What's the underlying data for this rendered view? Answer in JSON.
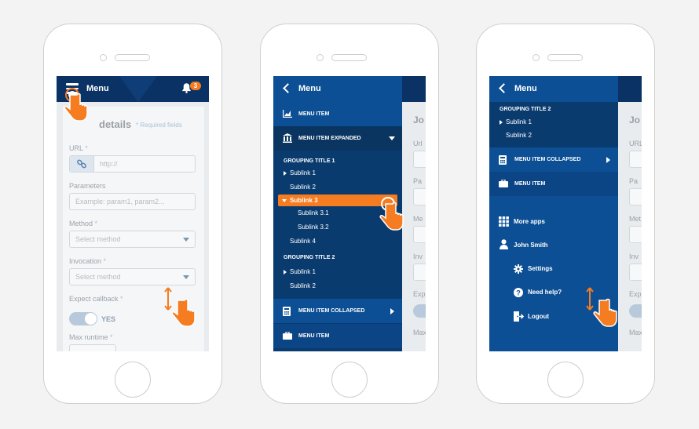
{
  "phone1": {
    "header_title": "Menu",
    "notification_count": "3",
    "form": {
      "title": "details",
      "required_note": "* Required fields",
      "url_label": "URL",
      "url_required": "*",
      "url_placeholder": "http://",
      "params_label": "Parameters",
      "params_placeholder": "Example: param1, param2...",
      "method_label": "Method",
      "method_required": "*",
      "method_placeholder": "Select method",
      "invocation_label": "Invocation",
      "invocation_required": "*",
      "invocation_placeholder": "Select method",
      "callback_label": "Expect callback",
      "callback_required": "*",
      "callback_toggle": "YES",
      "runtime_label": "Max runtime",
      "runtime_required": "*"
    }
  },
  "phone2": {
    "header_title": "Menu",
    "menu_item_1": "MENU ITEM",
    "menu_expanded": "MENU ITEM EXPANDED",
    "group_title_1": "GROUPING TITLE 1",
    "sublink_1": "Sublink 1",
    "sublink_2": "Sublink 2",
    "sublink_3": "Sublink 3",
    "sublink_3_1": "Sublink 3.1",
    "sublink_3_2": "Sublink 3.2",
    "sublink_4": "Sublink 4",
    "group_title_2": "GROUPING TITLE 2",
    "g2_sublink_1": "Sublink 1",
    "g2_sublink_2": "Sublink 2",
    "menu_collapsed": "MENU ITEM COLLAPSED",
    "menu_item_2": "MENU ITEM",
    "bg_text": [
      "Jo",
      "Url",
      "Pa",
      "Me",
      "Inv",
      "Exp",
      "Max"
    ]
  },
  "phone3": {
    "header_title": "Menu",
    "group_title_2": "GROUPING TITLE 2",
    "sublink_1": "Sublink 1",
    "sublink_2": "Sublink 2",
    "menu_collapsed": "MENU ITEM COLLAPSED",
    "menu_item": "MENU ITEM",
    "more_apps": "More apps",
    "user_name": "John Smith",
    "settings": "Settings",
    "help": "Need help?",
    "logout": "Logout",
    "bg_text": [
      "Jo",
      "URL",
      "Pa",
      "Met",
      "Inv",
      "Exp",
      "Max"
    ]
  },
  "colors": {
    "navy": "#0b3265",
    "menu_blue": "#0c4f94",
    "menu_dark": "#0a3b6f",
    "orange": "#f57c20"
  }
}
